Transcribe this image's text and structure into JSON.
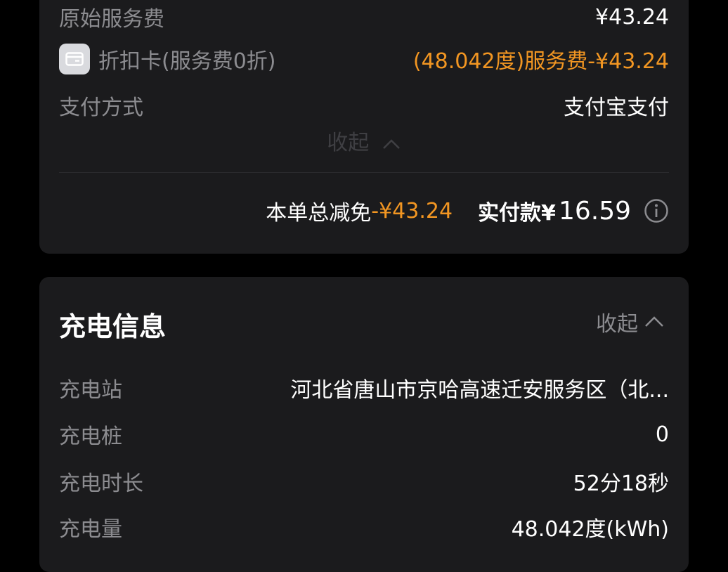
{
  "order": {
    "original_fee_label": "原始服务费",
    "original_fee_value": "¥43.24",
    "discount_label": "折扣卡(服务费0折)",
    "discount_value": "(48.042度)服务费-¥43.24",
    "payment_label": "支付方式",
    "payment_value": "支付宝支付",
    "collapse_label": "收起",
    "total_discount_label": "本单总减免",
    "total_discount_value": "-¥43.24",
    "paid_label": "实付款¥",
    "paid_amount": "16.59"
  },
  "charging": {
    "title": "充电信息",
    "collapse_label": "收起",
    "rows": [
      {
        "label": "充电站",
        "value": "河北省唐山市京哈高速迁安服务区（北..."
      },
      {
        "label": "充电桩",
        "value": "0"
      },
      {
        "label": "充电时长",
        "value": "52分18秒"
      },
      {
        "label": "充电量",
        "value": "48.042度(kWh)"
      }
    ]
  },
  "colors": {
    "background": "#000000",
    "card": "#1b1b1d",
    "accent_orange": "#f29622",
    "label_gray": "#8c8c90"
  },
  "icons": [
    "card-icon",
    "chevron-up-icon",
    "info-icon"
  ]
}
